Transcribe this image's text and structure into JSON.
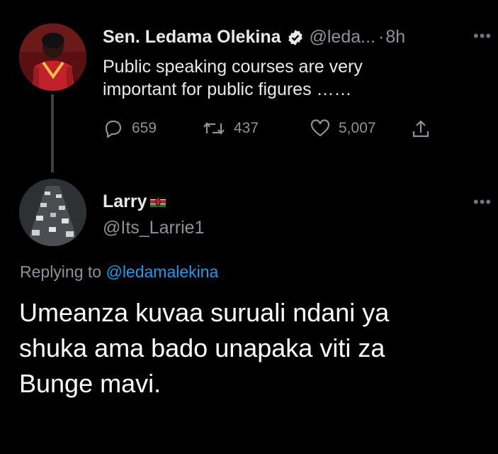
{
  "tweet": {
    "author_name": "Sen. Ledama Olekina",
    "handle": "@leda...",
    "dot": "·",
    "time": "8h",
    "text_lines": [
      "Public speaking courses are very",
      "important for public figures ……"
    ],
    "reply_count": "659",
    "retweet_count": "437",
    "like_count": "5,007",
    "icons": {
      "verified": "verified-badge-icon",
      "reply": "reply-icon",
      "retweet": "retweet-icon",
      "like": "heart-icon",
      "share": "share-icon",
      "more": "more-icon"
    }
  },
  "reply": {
    "author_name": "Larry",
    "flag": "kenya-flag-icon",
    "handle": "@Its_Larrie1",
    "replying_prefix": "Replying to",
    "replying_handle": "@ledamalekina",
    "text_lines": [
      "Umeanza kuvaa suruali ndani ya",
      "shuka ama bado unapaka viti za",
      "Bunge mavi."
    ]
  },
  "colors": {
    "background": "#000000",
    "text": "#e7e9ea",
    "secondary": "#8b9399",
    "link": "#1d9bf0"
  }
}
